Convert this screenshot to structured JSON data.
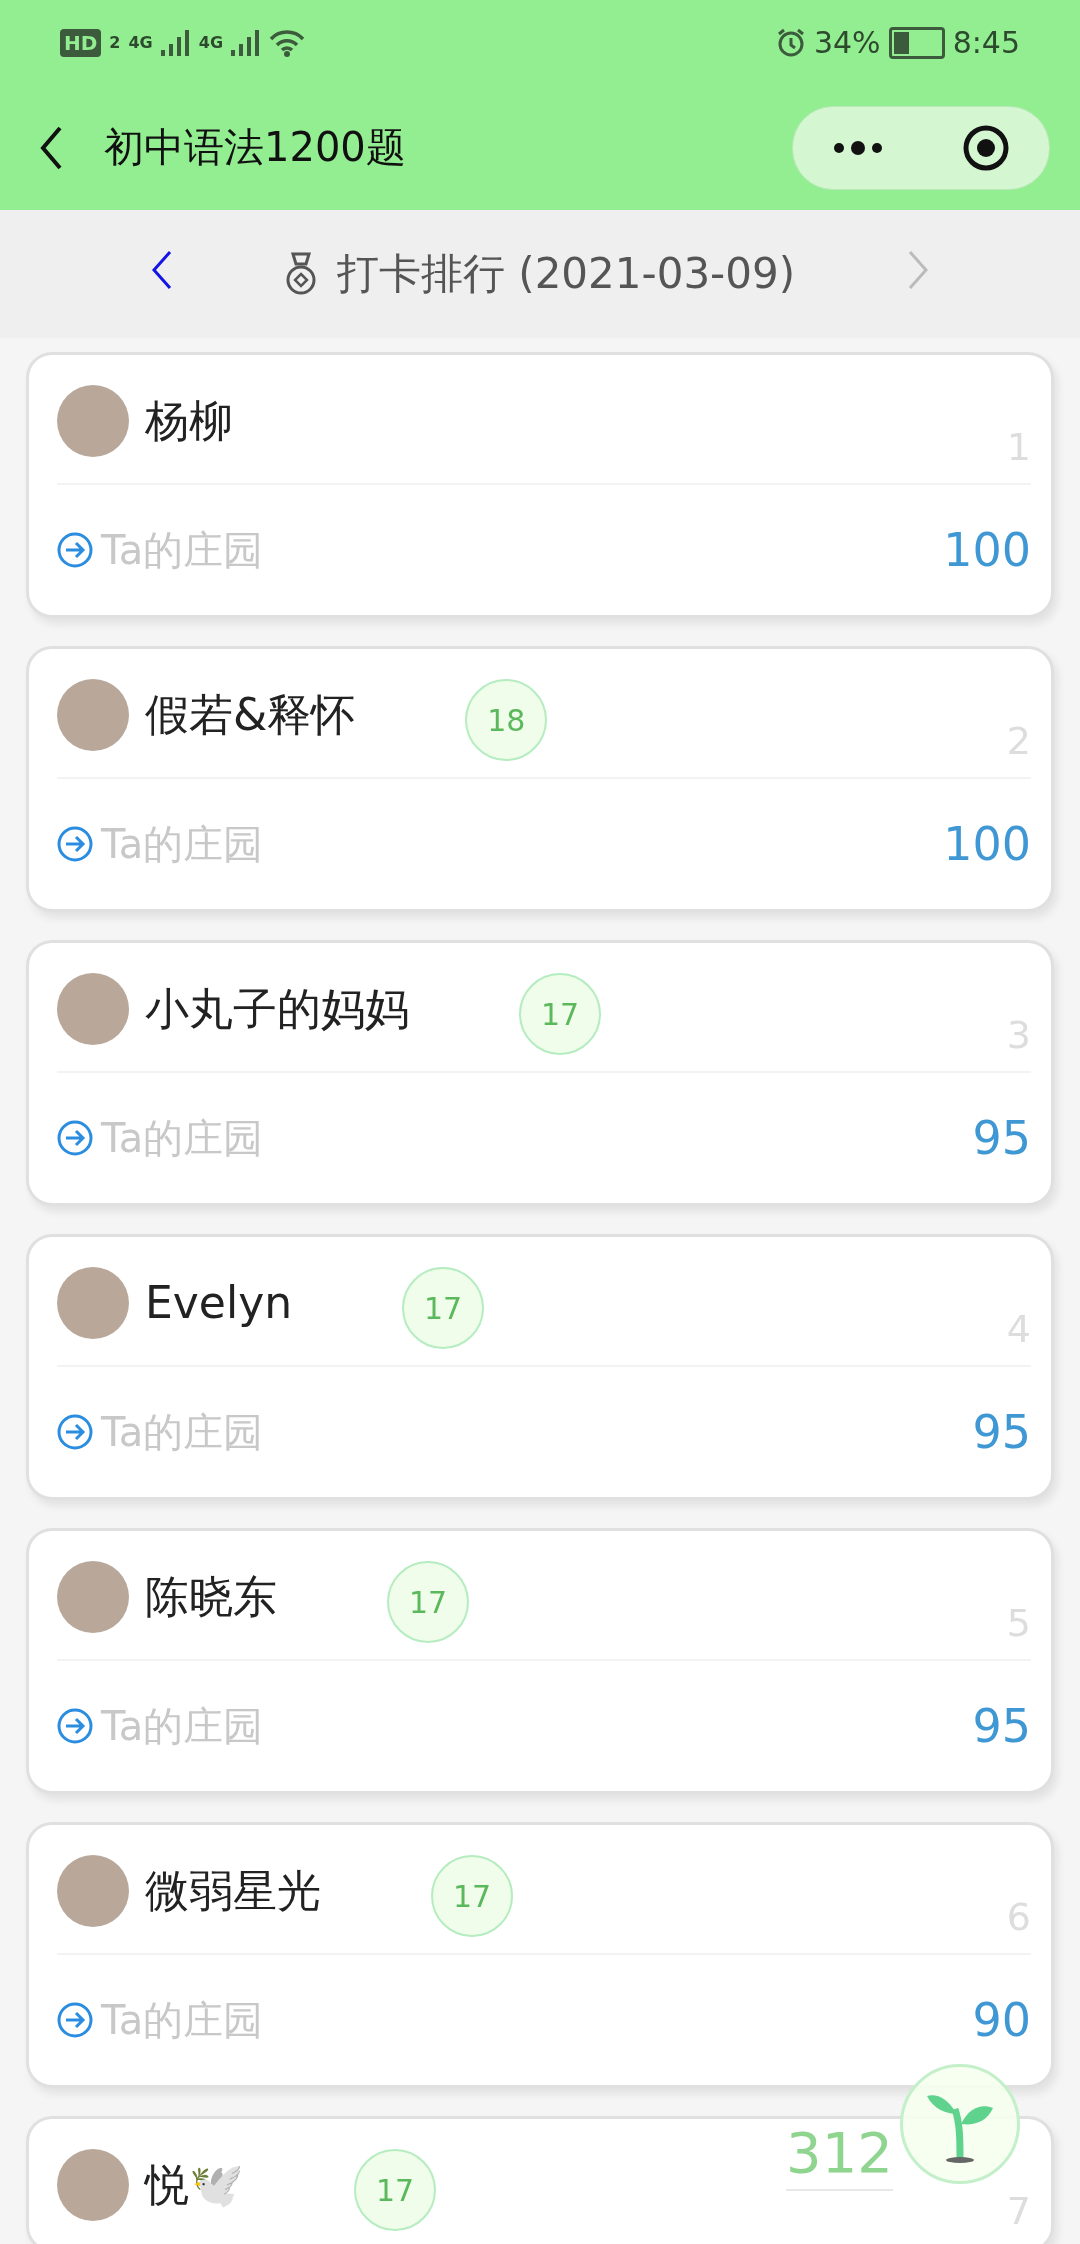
{
  "status_bar": {
    "hd": "HD",
    "sim": "2",
    "network_1": "4G",
    "network_2": "4G",
    "battery": "34%",
    "time": "8:45"
  },
  "app_bar": {
    "title": "初中语法1200题"
  },
  "ranking_header": {
    "title": "打卡排行 (2021-03-09)",
    "next_disabled": true
  },
  "entries": [
    {
      "name": "杨柳",
      "rank": "1",
      "garden_link": "Ta的庄园",
      "score": "100"
    },
    {
      "name": "假若&释怀",
      "badge": "18",
      "rank": "2",
      "garden_link": "Ta的庄园",
      "score": "100"
    },
    {
      "name": "小丸子的妈妈",
      "badge": "17",
      "rank": "3",
      "garden_link": "Ta的庄园",
      "score": "95"
    },
    {
      "name": "Evelyn",
      "badge": "17",
      "rank": "4",
      "garden_link": "Ta的庄园",
      "score": "95"
    },
    {
      "name": "陈晓东",
      "badge": "17",
      "rank": "5",
      "garden_link": "Ta的庄园",
      "score": "95"
    },
    {
      "name": "微弱星光",
      "badge": "17",
      "rank": "6",
      "garden_link": "Ta的庄园",
      "score": "90"
    },
    {
      "name": "悦🕊️",
      "badge": "17",
      "rank": "7"
    }
  ],
  "floating": {
    "count": "312"
  }
}
